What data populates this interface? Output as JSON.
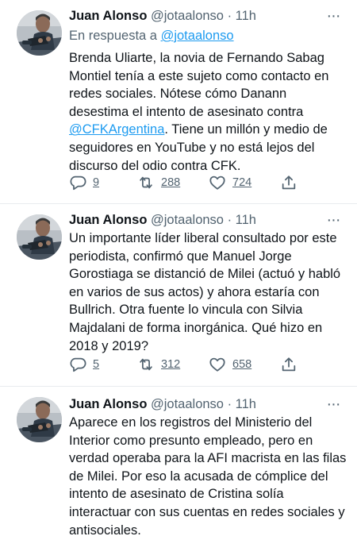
{
  "tweets": [
    {
      "author_name": "Juan Alonso",
      "author_handle": "@jotaalonso",
      "time": "· 11h",
      "more": "···",
      "reply_prefix": "En respuesta a",
      "reply_handle": "@jotaalonso",
      "text_before_link": "Brenda Uliarte, la novia de Fernando Sabag Montiel tenía a este sujeto como contacto en redes sociales. Nótese cómo Danann desestima el intento de asesinato contra ",
      "link": "@CFKArgentina",
      "text_after_link": ". Tiene un millón y medio de seguidores en YouTube y no está lejos del discurso del odio contra CFK.",
      "replies": "9",
      "retweets": "288",
      "likes": "724"
    },
    {
      "author_name": "Juan Alonso",
      "author_handle": "@jotaalonso",
      "time": "· 11h",
      "more": "···",
      "text": "Un importante líder liberal consultado por este periodista, confirmó que Manuel Jorge Gorostiaga se distanció de Milei (actuó y habló en varios de sus actos) y ahora estaría con Bullrich. Otra fuente lo vincula con Silvia Majdalani de forma inorgánica. Qué hizo en 2018 y 2019?",
      "replies": "5",
      "retweets": "312",
      "likes": "658"
    },
    {
      "author_name": "Juan Alonso",
      "author_handle": "@jotaalonso",
      "time": "· 11h",
      "more": "···",
      "text": "Aparece en los registros del Ministerio del Interior como presunto empleado, pero en verdad operaba para la AFI macrista en las filas de Milei. Por eso la acusada de cómplice del intento de asesinato de Cristina solía interactuar con sus cuentas en redes sociales y antisociales."
    }
  ],
  "icons": {
    "reply": "speech-bubble-icon",
    "retweet": "retweet-arrows-icon",
    "like": "heart-outline-icon",
    "share": "share-upload-icon",
    "more": "ellipsis-icon"
  },
  "colors": {
    "text": "#0f1419",
    "secondary": "#536471",
    "link": "#1d9bf0",
    "divider": "#e9ecef"
  }
}
